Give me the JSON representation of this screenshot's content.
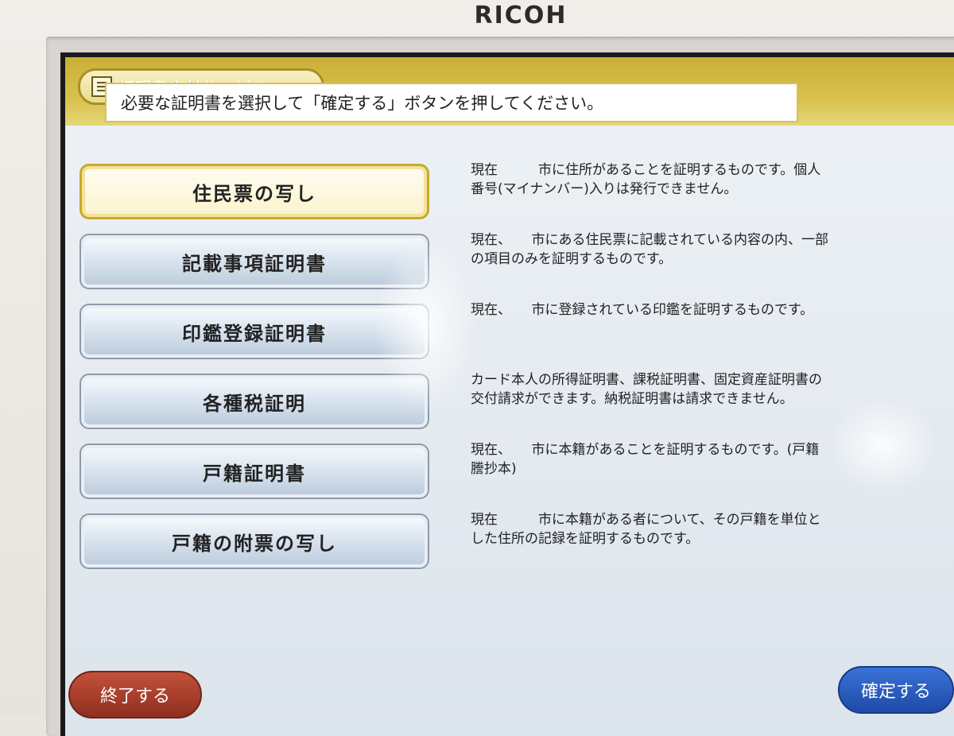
{
  "device": {
    "brand": "RICOH"
  },
  "header": {
    "service_title": "証明書交付サービス",
    "icon": "list-icon"
  },
  "instruction": "必要な証明書を選択して「確定する」ボタンを押してください。",
  "options": [
    {
      "label": "住民票の写し",
      "selected": true,
      "description": "現在　　　市に住所があることを証明するものです。個人番号(マイナンバー)入りは発行できません。"
    },
    {
      "label": "記載事項証明書",
      "selected": false,
      "description": "現在、　　市にある住民票に記載されている内容の内、一部の項目のみを証明するものです。"
    },
    {
      "label": "印鑑登録証明書",
      "selected": false,
      "description": "現在、　　市に登録されている印鑑を証明するものです。"
    },
    {
      "label": "各種税証明",
      "selected": false,
      "description": "カード本人の所得証明書、課税証明書、固定資産証明書の交付請求ができます。納税証明書は請求できません。"
    },
    {
      "label": "戸籍証明書",
      "selected": false,
      "description": "現在、　　市に本籍があることを証明するものです。(戸籍謄抄本)"
    },
    {
      "label": "戸籍の附票の写し",
      "selected": false,
      "description": "現在　　　市に本籍がある者について、その戸籍を単位とした住所の記録を証明するものです。"
    }
  ],
  "footer": {
    "exit_label": "終了する",
    "confirm_label": "確定する"
  },
  "colors": {
    "header_band": "#d7c04c",
    "selected_border": "#c9a92a",
    "exit": "#a83d2a",
    "confirm": "#2a5fc4"
  }
}
